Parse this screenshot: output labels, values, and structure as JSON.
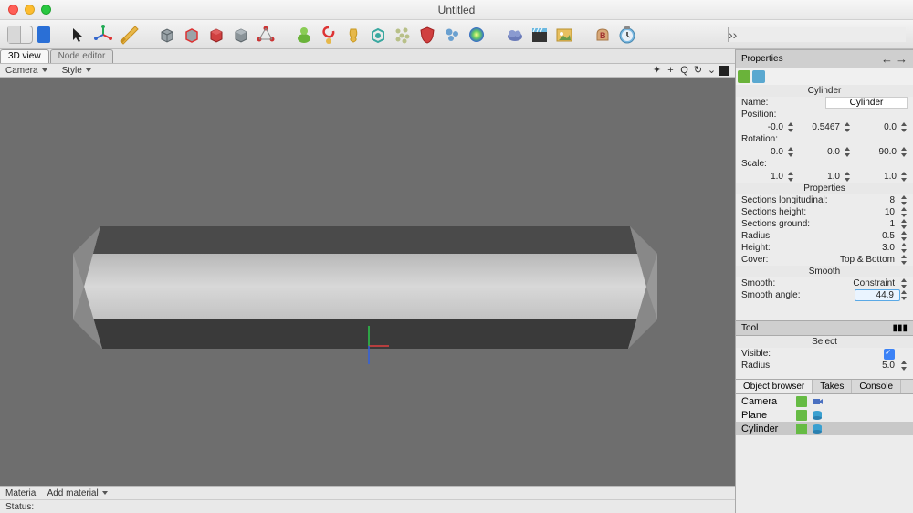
{
  "window": {
    "title": "Untitled"
  },
  "viewTabs": {
    "active": "3D view",
    "inactive": "Node editor"
  },
  "subbar": {
    "camera": "Camera",
    "style": "Style"
  },
  "bottombar": {
    "material": "Material",
    "addMaterial": "Add material"
  },
  "statusbar": {
    "label": "Status:"
  },
  "properties": {
    "header": "Properties",
    "objectLabel": "Cylinder",
    "nameLabel": "Name:",
    "nameValue": "Cylinder",
    "positionLabel": "Position:",
    "position": [
      "-0.0",
      "0.5467",
      "0.0"
    ],
    "rotationLabel": "Rotation:",
    "rotation": [
      "0.0",
      "0.0",
      "90.0"
    ],
    "scaleLabel": "Scale:",
    "scale": [
      "1.0",
      "1.0",
      "1.0"
    ],
    "propsHeader": "Properties",
    "sectionsLong": {
      "k": "Sections longitudinal:",
      "v": "8"
    },
    "sectionsHeight": {
      "k": "Sections height:",
      "v": "10"
    },
    "sectionsGround": {
      "k": "Sections ground:",
      "v": "1"
    },
    "radius": {
      "k": "Radius:",
      "v": "0.5"
    },
    "height": {
      "k": "Height:",
      "v": "3.0"
    },
    "cover": {
      "k": "Cover:",
      "v": "Top & Bottom"
    },
    "smoothHeader": "Smooth",
    "smooth": {
      "k": "Smooth:",
      "v": "Constraint"
    },
    "smoothAngle": {
      "k": "Smooth angle:",
      "v": "44.9"
    }
  },
  "tool": {
    "header": "Tool",
    "selectLabel": "Select",
    "visible": {
      "k": "Visible:"
    },
    "radius": {
      "k": "Radius:",
      "v": "5.0"
    }
  },
  "browser": {
    "tabs": [
      "Object browser",
      "Takes",
      "Console"
    ],
    "items": [
      {
        "name": "Camera",
        "swatch": "#66bb44",
        "iconColor": "#4a70c0"
      },
      {
        "name": "Plane",
        "swatch": "#66bb44",
        "iconColor": "#3aa0d0"
      },
      {
        "name": "Cylinder",
        "swatch": "#66bb44",
        "iconColor": "#3aa0d0"
      }
    ]
  }
}
